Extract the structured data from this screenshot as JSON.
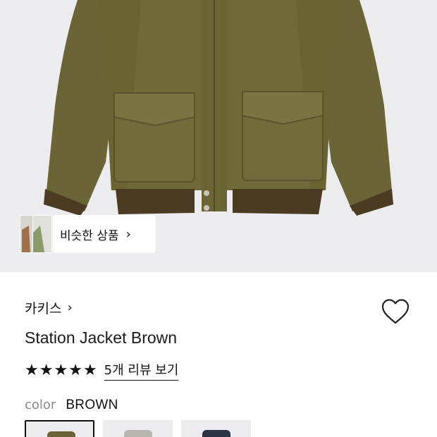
{
  "product": {
    "similar_button_label": "비슷한 상품",
    "brand_name": "카키스",
    "title": "Station Jacket Brown",
    "rating_stars": 5,
    "review_link": "5개 리뷰 보기",
    "color_label": "color",
    "color_value": "BROWN",
    "swatches": [
      {
        "name": "brown",
        "selected": true,
        "color": "#6b6238"
      },
      {
        "name": "gray",
        "selected": false,
        "color": "#b9b6b1"
      },
      {
        "name": "navy",
        "selected": false,
        "color": "#2c3448"
      }
    ]
  },
  "icons": {
    "chevron": "chevron-right-icon",
    "wishlist": "heart-outline-icon",
    "star": "star-filled-icon"
  },
  "colors": {
    "jacket": "#6e6838",
    "rib": "#4a3a22",
    "background": "#ececee"
  }
}
